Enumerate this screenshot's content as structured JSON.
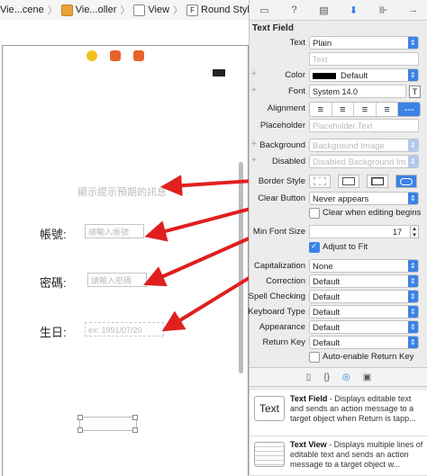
{
  "breadcrumb": {
    "items": [
      "Vie...cene",
      "Vie...oller",
      "View",
      "Round Style Text Field"
    ],
    "separator": "〉"
  },
  "canvas": {
    "placeholder_demo": "顯示提示預期的訊息",
    "label_account": "帳號:",
    "field_account_placeholder": "請輸入帳號",
    "label_password": "密碼:",
    "field_password_placeholder": "請輸入密碼",
    "label_birthday": "生日:",
    "field_birthday_placeholder": "ex: 1991/07/20"
  },
  "inspector": {
    "section_title": "Text Field",
    "text_label": "Text",
    "text_value": "Plain",
    "text_field_placeholder": "Text",
    "color_label": "Color",
    "color_value": "Default",
    "font_label": "Font",
    "font_value": "System 14.0",
    "alignment_label": "Alignment",
    "placeholder_label": "Placeholder",
    "placeholder_field_placeholder": "Placeholder Text",
    "background_label": "Background",
    "background_placeholder": "Background Image",
    "disabled_label": "Disabled",
    "disabled_placeholder": "Disabled Background Im",
    "border_style_label": "Border Style",
    "clear_button_label": "Clear Button",
    "clear_button_value": "Never appears",
    "clear_when_editing": "Clear when editing begins",
    "min_font_label": "Min Font Size",
    "min_font_value": "17",
    "adjust_to_fit": "Adjust to Fit",
    "capitalization_label": "Capitalization",
    "capitalization_value": "None",
    "correction_label": "Correction",
    "correction_value": "Default",
    "spell_label": "Spell Checking",
    "spell_value": "Default",
    "keyboard_label": "Keyboard Type",
    "keyboard_value": "Default",
    "appearance_label": "Appearance",
    "appearance_value": "Default",
    "return_label": "Return Key",
    "return_value": "Default",
    "auto_enable": "Auto-enable Return Key"
  },
  "library": {
    "items": [
      {
        "thumb": "Text",
        "name": "Text Field",
        "desc": " - Displays editable text and sends an action message to a target object when Return is tapp..."
      },
      {
        "thumb": "",
        "name": "Text View",
        "desc": " - Displays multiple lines of editable text and sends an action message to a target object w..."
      }
    ]
  },
  "colors": {
    "accent": "#3b82e6",
    "arrow": "#e01f1f"
  }
}
